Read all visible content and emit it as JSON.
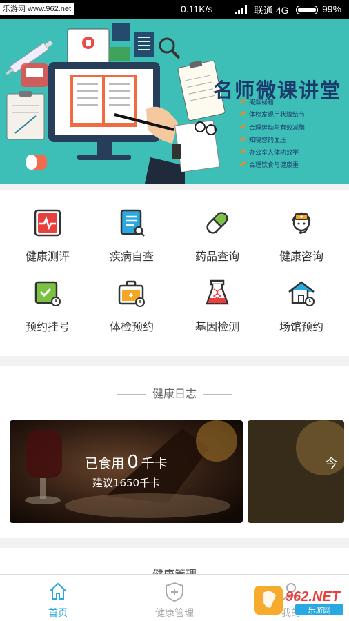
{
  "status_bar": {
    "watermark": "乐游网 www.962.net",
    "net_speed": "0.11K/s",
    "carrier": "联通 4G",
    "battery_pct": "99%",
    "battery_level": 0.99
  },
  "banner": {
    "title": "名师微课讲堂",
    "bullets": [
      "戒烟秘籍",
      "体检发现甲状腺结节",
      "合理运动与有效减脂",
      "知晓您的血压",
      "办公室人体功效学",
      "合理饮食与健康重"
    ]
  },
  "features": [
    {
      "label": "健康测评",
      "icon": "heart-monitor-icon"
    },
    {
      "label": "疾病自查",
      "icon": "document-search-icon"
    },
    {
      "label": "药品查询",
      "icon": "pill-capsule-icon"
    },
    {
      "label": "健康咨询",
      "icon": "doctor-headset-icon"
    },
    {
      "label": "预约挂号",
      "icon": "calendar-clock-icon"
    },
    {
      "label": "体检预约",
      "icon": "medical-kit-clock-icon"
    },
    {
      "label": "基因检测",
      "icon": "dna-flask-icon"
    },
    {
      "label": "场馆预约",
      "icon": "house-clock-icon"
    }
  ],
  "journal": {
    "title": "健康日志",
    "diet": {
      "eaten_prefix": "已食用",
      "eaten_value": "0",
      "eaten_unit": "千卡",
      "suggest": "建议1650千卡"
    },
    "second_card_peek": "今"
  },
  "manage": {
    "title": "健康管理"
  },
  "tabs": [
    {
      "label": "首页",
      "icon": "home-icon",
      "active": true
    },
    {
      "label": "健康管理",
      "icon": "shield-plus-icon",
      "active": false
    },
    {
      "label": "我的",
      "icon": "user-icon",
      "active": false
    }
  ],
  "colors": {
    "accent": "#2aa8e0",
    "banner_bg": "#3dbfb8",
    "inactive": "#aaaaaa",
    "text": "#333333"
  },
  "footer_watermark": {
    "text": "962.NET",
    "sub": "乐游网"
  }
}
